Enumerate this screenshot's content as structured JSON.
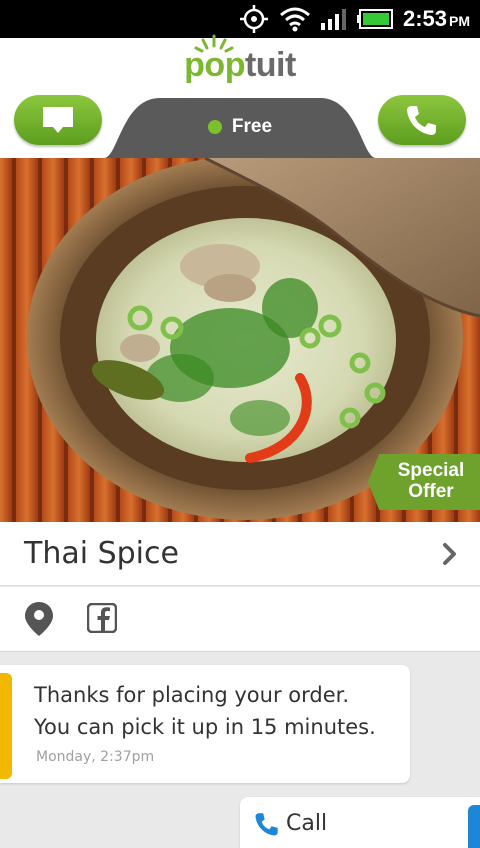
{
  "status_bar": {
    "time": "2:53",
    "ampm": "PM",
    "icons": [
      "gps-icon",
      "wifi-icon",
      "signal-icon",
      "battery-icon"
    ]
  },
  "header": {
    "logo_pop": "pop",
    "logo_tuit": "tuit",
    "status": "Free",
    "status_color": "#7cc02e",
    "message_button_icon": "message-icon",
    "call_button_icon": "phone-icon"
  },
  "hero": {
    "ribbon_line1": "Special",
    "ribbon_line2": "Offer"
  },
  "restaurant": {
    "name": "Thai Spice",
    "icons": [
      "location-pin-icon",
      "facebook-icon"
    ]
  },
  "messages": [
    {
      "line1": "Thanks for placing your order.",
      "line2": "You can pick it up in 15 minutes.",
      "time": "Monday, 2:37pm",
      "accent": "#f2b800"
    }
  ],
  "call_card": {
    "label": "Call",
    "accent": "#1d86d6"
  },
  "colors": {
    "brand_green": "#7cb82f",
    "dark_tab": "#5a5a5a"
  }
}
